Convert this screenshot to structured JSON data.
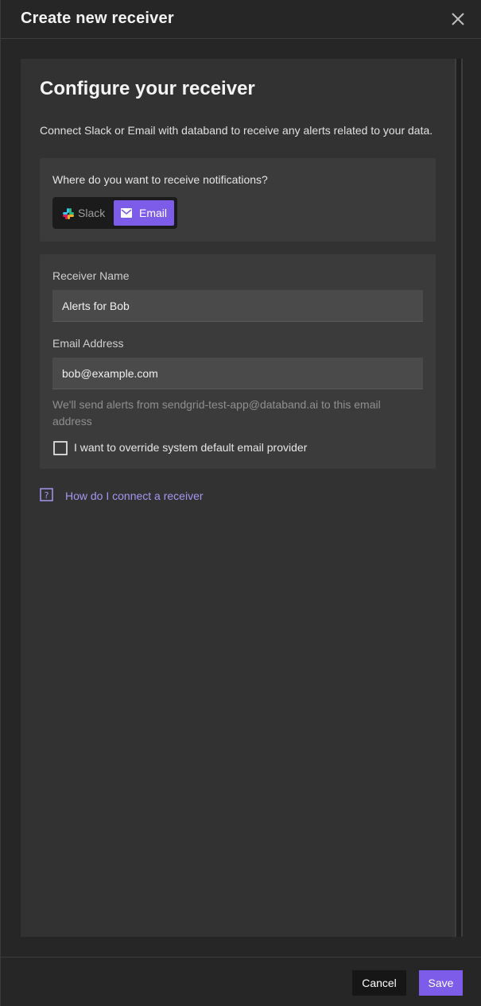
{
  "header": {
    "title": "Create new receiver"
  },
  "panel": {
    "heading": "Configure your receiver",
    "description": "Connect Slack or Email with databand to receive any alerts related to your data."
  },
  "receiver_type": {
    "question": "Where do you want to receive notifications?",
    "options": [
      {
        "label": "Slack",
        "icon": "slack-icon",
        "selected": false
      },
      {
        "label": "Email",
        "icon": "mail-icon",
        "selected": true
      }
    ]
  },
  "form": {
    "receiver_name_label": "Receiver Name",
    "receiver_name_value": "Alerts for Bob",
    "email_label": "Email Address",
    "email_value": "bob@example.com",
    "helper_text": "We'll send alerts from sendgrid-test-app@databand.ai to this email address",
    "override_label": "I want to override system default email provider",
    "override_checked": false
  },
  "help": {
    "link_text": "How do I connect a receiver",
    "icon": "question-icon"
  },
  "footer": {
    "cancel_label": "Cancel",
    "save_label": "Save"
  },
  "colors": {
    "accent": "#7c5ce8",
    "link": "#a795f0",
    "background": "#262626",
    "panel": "#323232",
    "card": "#3b3b3b"
  }
}
